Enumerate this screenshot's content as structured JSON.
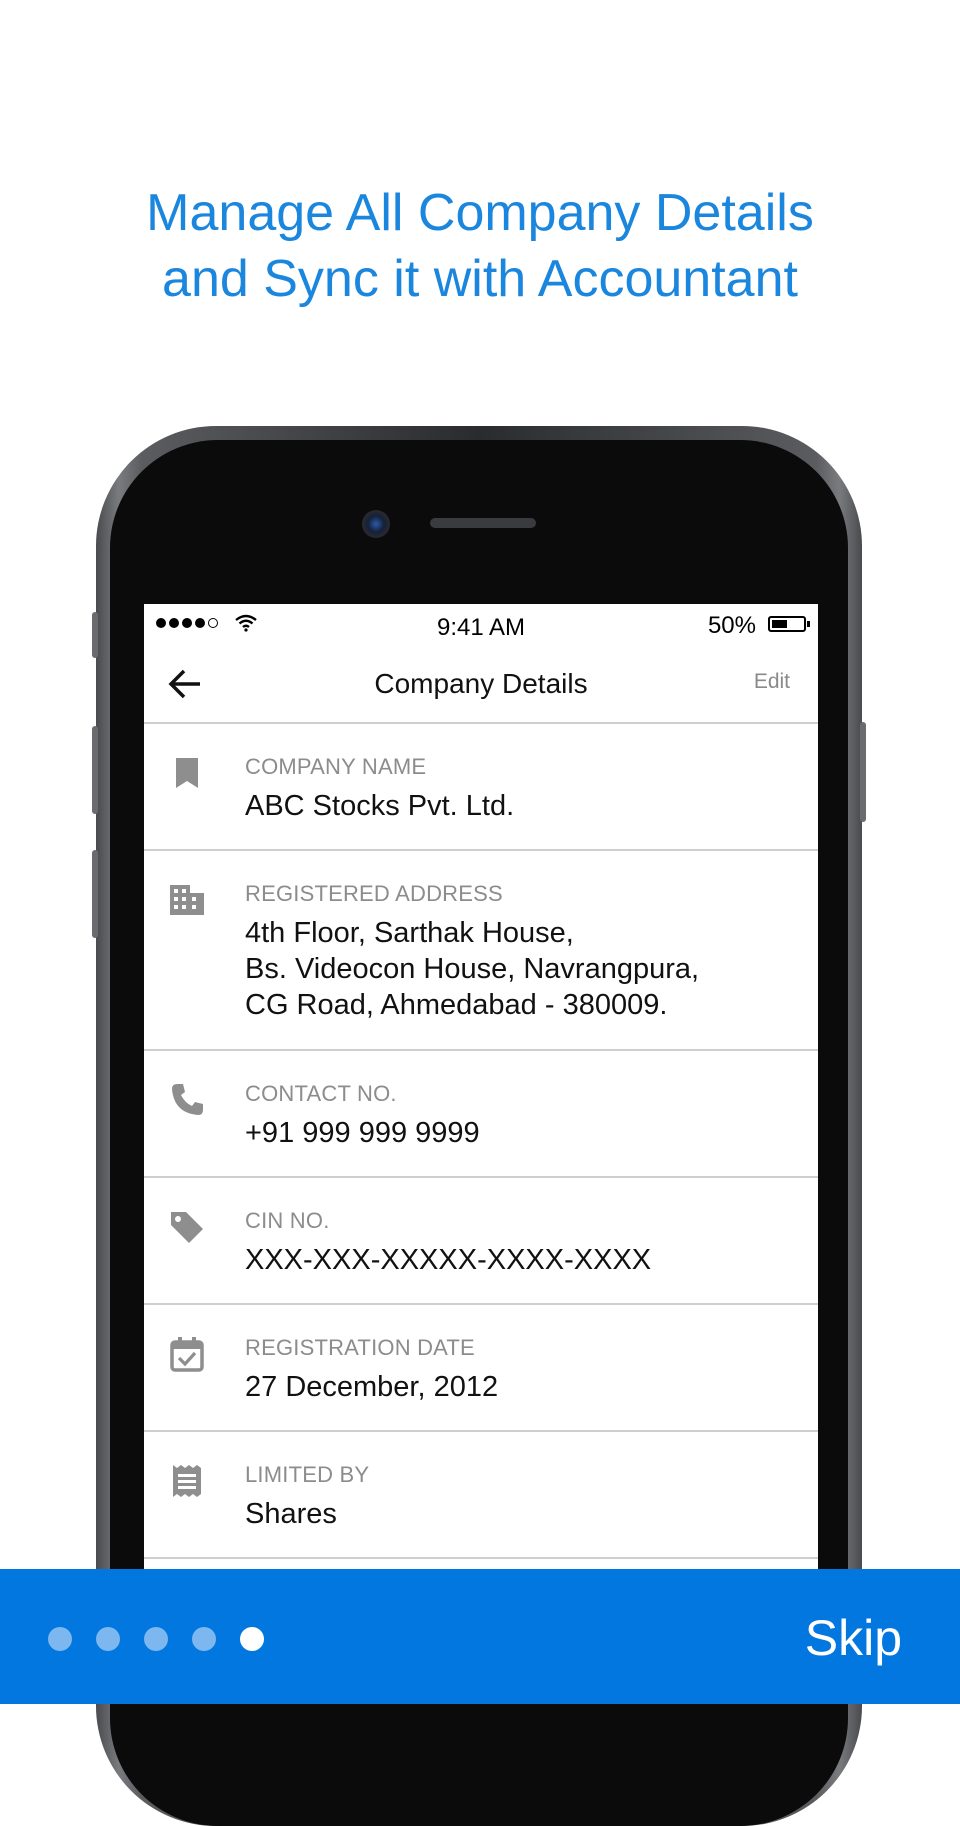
{
  "headline": {
    "line1": "Manage All Company Details",
    "line2": "and Sync it with Accountant"
  },
  "status_bar": {
    "time": "9:41 AM",
    "battery": "50%"
  },
  "navbar": {
    "back_icon": "arrow-left-icon",
    "title": "Company Details",
    "edit_label": "Edit"
  },
  "details": [
    {
      "icon": "bookmark-icon",
      "label": "COMPANY NAME",
      "lines": [
        "ABC Stocks Pvt. Ltd."
      ]
    },
    {
      "icon": "building-icon",
      "label": "REGISTERED ADDRESS",
      "lines": [
        "4th Floor, Sarthak House,",
        "Bs. Videocon House, Navrangpura,",
        "CG Road, Ahmedabad - 380009."
      ]
    },
    {
      "icon": "phone-icon",
      "label": "CONTACT NO.",
      "lines": [
        "+91 999 999 9999"
      ]
    },
    {
      "icon": "tag-icon",
      "label": "CIN NO.",
      "lines": [
        "XXX-XXX-XXXXX-XXXX-XXXX"
      ]
    },
    {
      "icon": "calendar-check-icon",
      "label": "REGISTRATION DATE",
      "lines": [
        "27 December, 2012"
      ]
    },
    {
      "icon": "receipt-icon",
      "label": "LIMITED BY",
      "lines": [
        "Shares"
      ]
    }
  ],
  "pager": {
    "total": 5,
    "active_index": 4
  },
  "skip_label": "Skip",
  "colors": {
    "accent": "#0277e0",
    "headline": "#1a86dd",
    "icon": "#8e8e8e"
  }
}
